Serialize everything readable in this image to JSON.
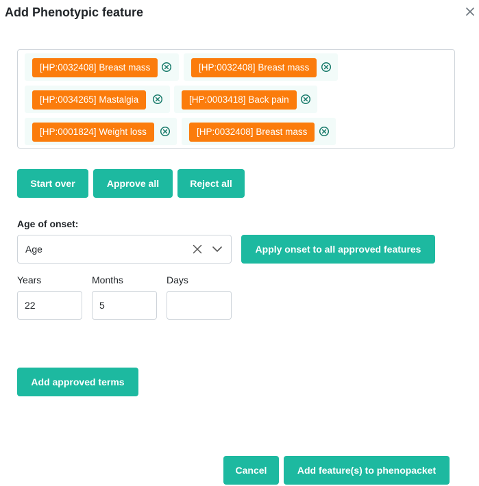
{
  "dialog": {
    "title": "Add Phenotypic feature"
  },
  "tags": [
    {
      "label": "[HP:0032408] Breast mass"
    },
    {
      "label": "[HP:0032408] Breast mass"
    },
    {
      "label": "[HP:0034265] Mastalgia"
    },
    {
      "label": "[HP:0003418] Back pain"
    },
    {
      "label": "[HP:0001824] Weight loss"
    },
    {
      "label": "[HP:0032408] Breast mass"
    }
  ],
  "actions": {
    "start_over": "Start over",
    "approve_all": "Approve all",
    "reject_all": "Reject all"
  },
  "onset": {
    "label": "Age of onset:",
    "selected": "Age",
    "apply_button": "Apply onset to all approved features"
  },
  "age": {
    "years_label": "Years",
    "years_value": "22",
    "months_label": "Months",
    "months_value": "5",
    "days_label": "Days",
    "days_value": ""
  },
  "add_terms_button": "Add approved terms",
  "footer": {
    "cancel": "Cancel",
    "add_features": "Add feature(s) to phenopacket"
  },
  "colors": {
    "accent": "#1db9a0",
    "tag": "#fb7c0c",
    "tag_bg": "#f2fbf9",
    "remove_icon": "#177a6a"
  }
}
